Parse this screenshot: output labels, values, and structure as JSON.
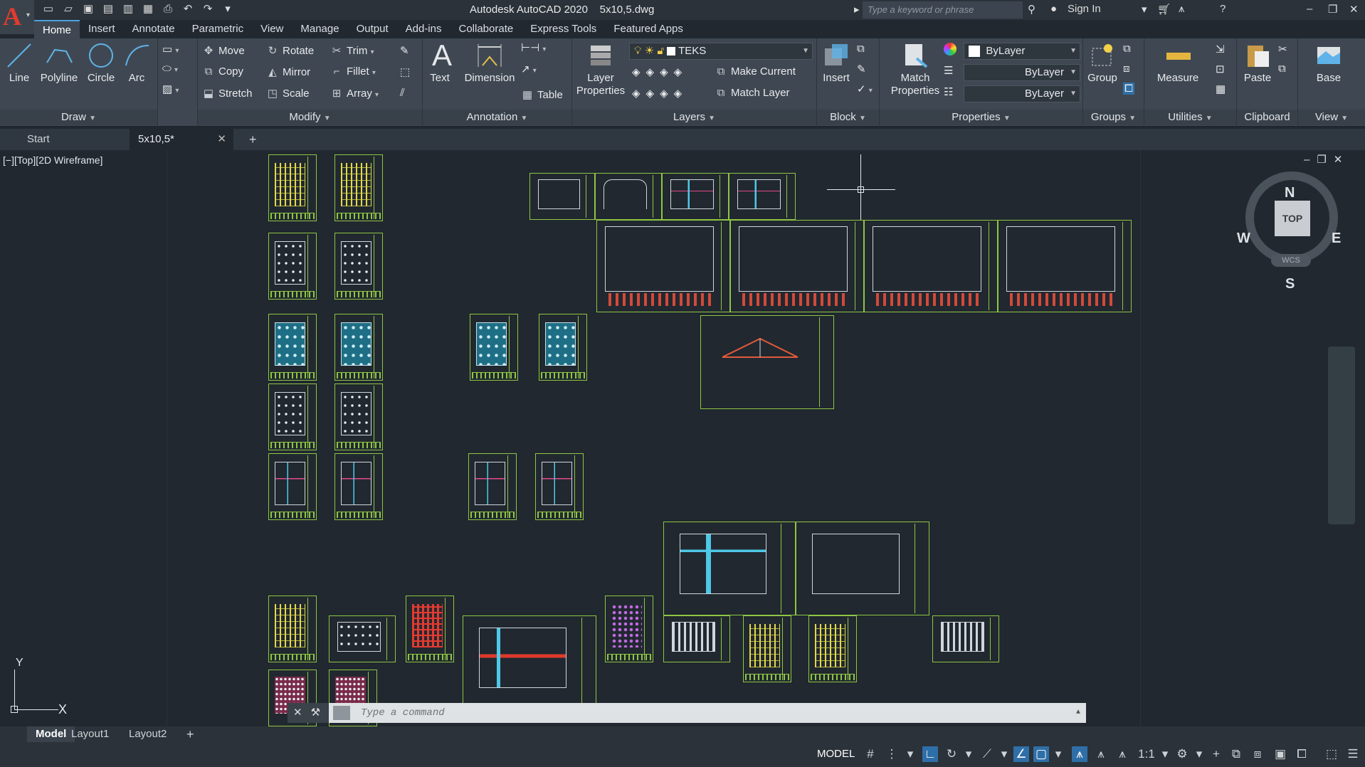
{
  "app": {
    "title": "Autodesk AutoCAD 2020",
    "file": "5x10,5.dwg",
    "search_placeholder": "Type a keyword or phrase",
    "sign_in": "Sign In"
  },
  "ribbon_tabs": [
    "Home",
    "Insert",
    "Annotate",
    "Parametric",
    "View",
    "Manage",
    "Output",
    "Add-ins",
    "Collaborate",
    "Express Tools",
    "Featured Apps"
  ],
  "draw": {
    "title": "Draw",
    "line": "Line",
    "polyline": "Polyline",
    "circle": "Circle",
    "arc": "Arc"
  },
  "modify": {
    "title": "Modify",
    "move": "Move",
    "rotate": "Rotate",
    "trim": "Trim",
    "copy": "Copy",
    "mirror": "Mirror",
    "fillet": "Fillet",
    "stretch": "Stretch",
    "scale": "Scale",
    "array": "Array"
  },
  "annotation": {
    "title": "Annotation",
    "text": "Text",
    "dimension": "Dimension",
    "table": "Table"
  },
  "layers": {
    "title": "Layers",
    "layer_properties_1": "Layer",
    "layer_properties_2": "Properties",
    "current_layer": "TEKS",
    "make_current": "Make Current",
    "match_layer": "Match Layer"
  },
  "block": {
    "title": "Block",
    "insert": "Insert"
  },
  "properties": {
    "title": "Properties",
    "match_1": "Match",
    "match_2": "Properties",
    "color": "ByLayer",
    "linetype": "ByLayer",
    "lineweight": "ByLayer"
  },
  "groups": {
    "title": "Groups",
    "group": "Group"
  },
  "utilities": {
    "title": "Utilities",
    "measure": "Measure"
  },
  "clipboard": {
    "title": "Clipboard",
    "paste": "Paste"
  },
  "view": {
    "title": "View",
    "base": "Base"
  },
  "file_tabs": {
    "start": "Start",
    "current": "5x10,5*",
    "close": "✕",
    "add": "+"
  },
  "viewport": {
    "label": "[−][Top][2D Wireframe]"
  },
  "viewcube": {
    "n": "N",
    "s": "S",
    "e": "E",
    "w": "W",
    "top": "TOP",
    "wcs": "WCS"
  },
  "ucs": {
    "x": "X",
    "y": "Y"
  },
  "command": {
    "placeholder": "Type a command"
  },
  "layout_tabs": [
    "Model",
    "Layout1",
    "Layout2"
  ],
  "status": {
    "model": "MODEL",
    "scale": "1:1"
  }
}
